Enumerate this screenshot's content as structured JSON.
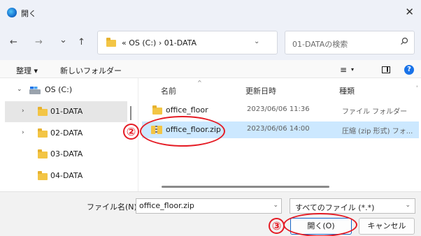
{
  "window": {
    "title": "開く",
    "close_glyph": "✕"
  },
  "nav": {
    "back": "←",
    "forward": "→",
    "history": "⌄",
    "up": "↑",
    "refresh": "C"
  },
  "address": {
    "text": "« OS (C:) › 01-DATA",
    "chevron": "⌄"
  },
  "search": {
    "placeholder": "01-DATAの検索"
  },
  "toolbar": {
    "organize": "整理 ▾",
    "new_folder": "新しいフォルダー",
    "view": "≡",
    "view_chevron": "▾",
    "help": "?"
  },
  "sidebar": {
    "items": [
      {
        "label": "OS (C:)",
        "chevron": "⌄"
      },
      {
        "label": "01-DATA",
        "chevron": "›"
      },
      {
        "label": "02-DATA",
        "chevron": "›"
      },
      {
        "label": "03-DATA"
      },
      {
        "label": "04-DATA"
      }
    ]
  },
  "columns": {
    "name": "名前",
    "sort": "^",
    "date": "更新日時",
    "type": "種類",
    "edge": "'"
  },
  "files": [
    {
      "name": "office_floor",
      "date": "2023/06/06 11:36",
      "type": "ファイル フォルダー"
    },
    {
      "name": "office_floor.zip",
      "date": "2023/06/06 14:00",
      "type": "圧縮 (zip 形式) フォ..."
    }
  ],
  "footer": {
    "filename_label": "ファイル名(N):",
    "filename_value": "office_floor.zip",
    "filetype": "すべてのファイル (*.*)",
    "chevron": "⌄",
    "open_button": "開く(O)",
    "cancel_button": "キャンセル"
  },
  "annotations": {
    "marker_2": "②",
    "marker_3": "③",
    "color": "#e51b24"
  },
  "colors": {
    "accent": "#1a66c7",
    "selection": "#cce8ff",
    "folder": "#f3c545"
  }
}
